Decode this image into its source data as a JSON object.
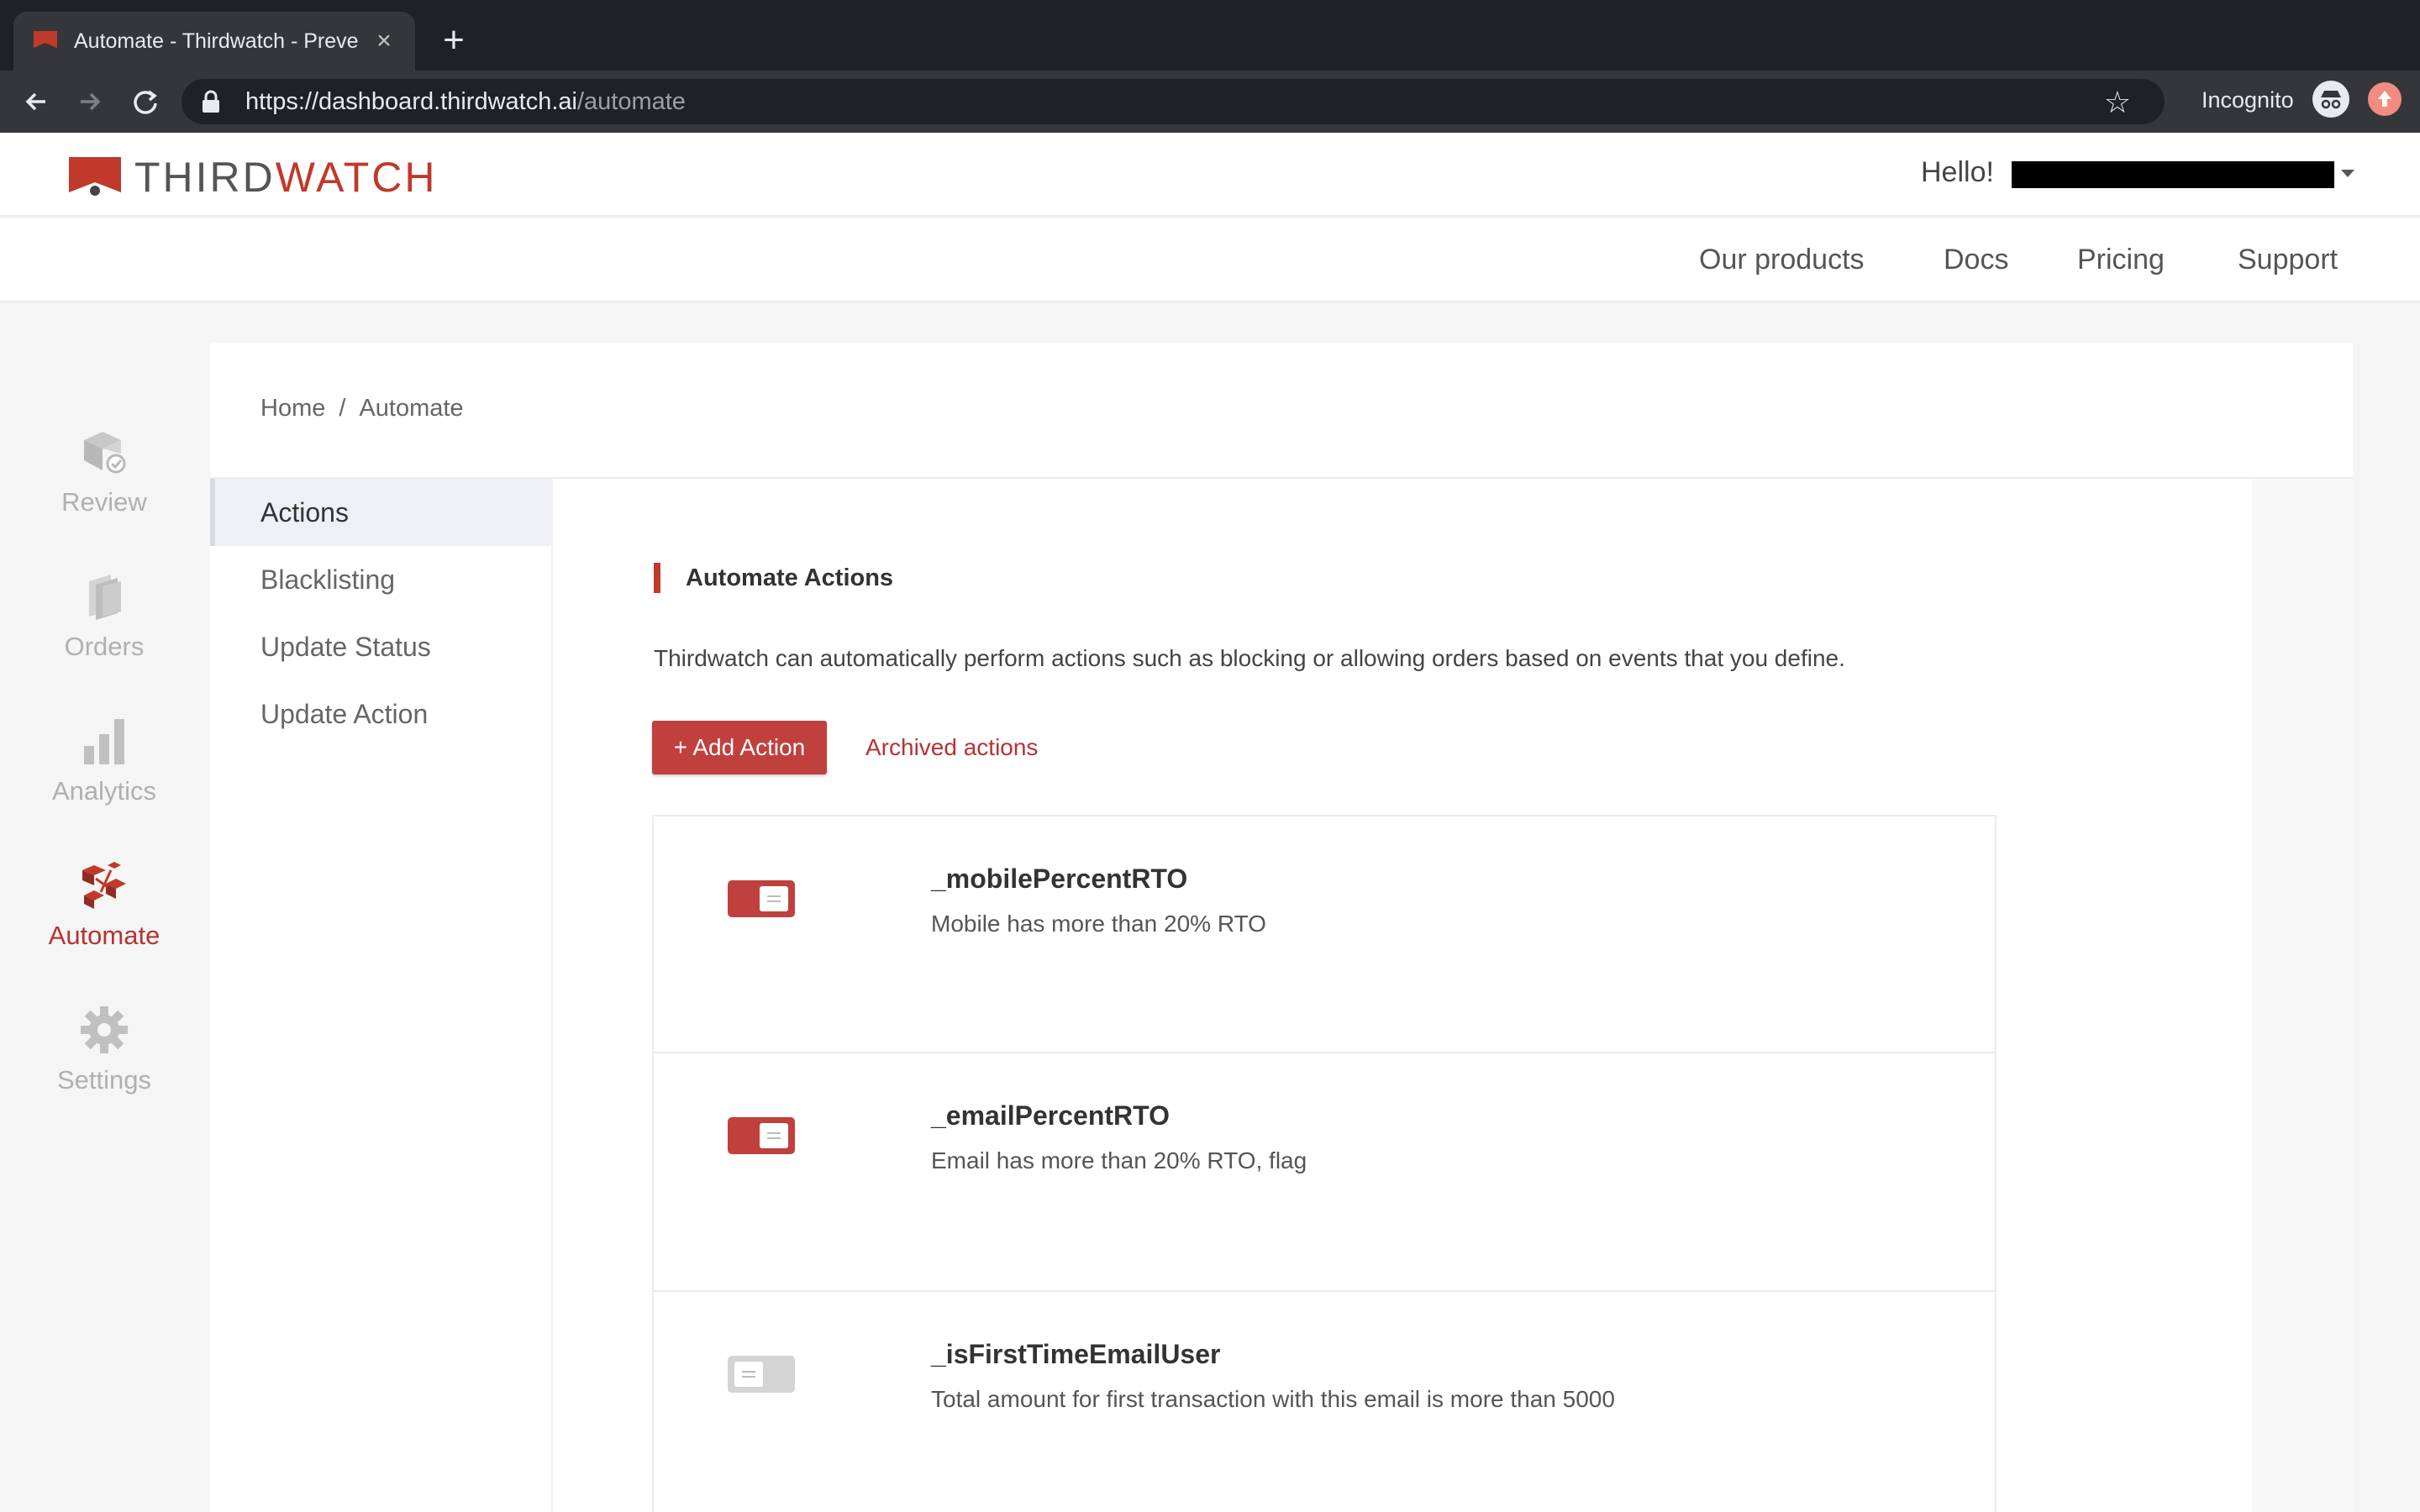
{
  "browser": {
    "tab_title": "Automate - Thirdwatch - Preve",
    "url_host": "https://dashboard.thirdwatch.ai",
    "url_path": "/automate",
    "incognito_label": "Incognito"
  },
  "header": {
    "logo_third": "THIRD",
    "logo_watch": "WATCH",
    "greeting": "Hello!"
  },
  "top_nav": {
    "items": [
      "Our products",
      "Docs",
      "Pricing",
      "Support"
    ]
  },
  "rail": {
    "items": [
      {
        "label": "Review",
        "icon": "review-box-icon"
      },
      {
        "label": "Orders",
        "icon": "orders-stack-icon"
      },
      {
        "label": "Analytics",
        "icon": "bar-chart-icon"
      },
      {
        "label": "Automate",
        "icon": "automate-icon",
        "active": true
      },
      {
        "label": "Settings",
        "icon": "gear-icon"
      }
    ]
  },
  "breadcrumb": {
    "home": "Home",
    "separator": "/",
    "current": "Automate"
  },
  "subnav": {
    "items": [
      "Actions",
      "Blacklisting",
      "Update Status",
      "Update Action"
    ],
    "active": "Actions"
  },
  "main": {
    "section_title": "Automate Actions",
    "description": "Thirdwatch can automatically perform actions such as blocking or allowing orders based on events that you define.",
    "add_button": "+ Add Action",
    "archived_link": "Archived actions"
  },
  "actions": [
    {
      "name": "_mobilePercentRTO",
      "description": "Mobile has more than 20% RTO",
      "enabled": true
    },
    {
      "name": "_emailPercentRTO",
      "description": "Email has more than 20% RTO, flag",
      "enabled": true
    },
    {
      "name": "_isFirstTimeEmailUser",
      "description": "Total amount for first transaction with this email is more than 5000",
      "enabled": false
    }
  ],
  "colors": {
    "brand_red": "#c0392b",
    "button_red": "#c0403d",
    "rail_inactive": "#b0b0b0"
  }
}
